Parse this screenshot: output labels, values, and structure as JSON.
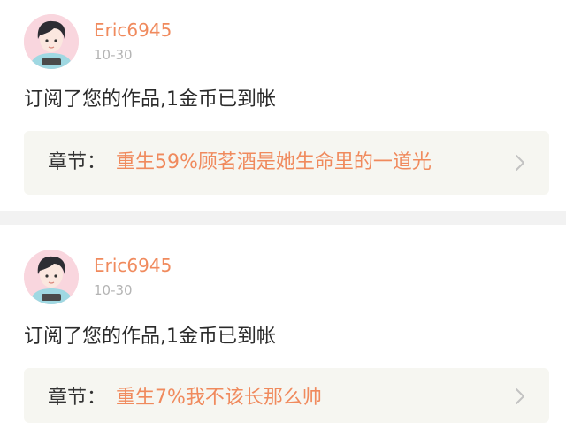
{
  "notifications": [
    {
      "user": {
        "name": "Eric6945",
        "avatar": "anime-boy-avatar"
      },
      "timestamp": "10-30",
      "message": "订阅了您的作品,1金币已到帐",
      "chapter": {
        "label": "章节：",
        "title": "重生59%顾茗酒是她生命里的一道光"
      }
    },
    {
      "user": {
        "name": "Eric6945",
        "avatar": "anime-boy-avatar"
      },
      "timestamp": "10-30",
      "message": "订阅了您的作品,1金币已到帐",
      "chapter": {
        "label": "章节：",
        "title": "重生7%我不该长那么帅"
      }
    }
  ],
  "colors": {
    "accent": "#f08a5d",
    "muted": "#b4b4b4",
    "text": "#2b2b2b",
    "chapter_bg": "#f6f6f1",
    "separator": "#f2f2f2"
  },
  "icons": {
    "chapter_arrow": "chevron-right-icon"
  }
}
